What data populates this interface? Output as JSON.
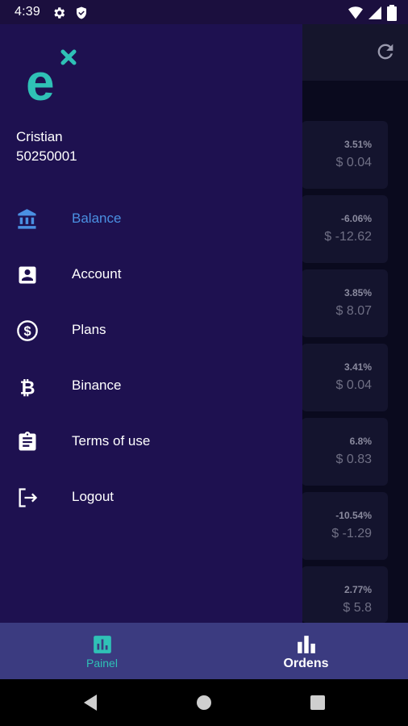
{
  "status_bar": {
    "time": "4:39",
    "left_icons": [
      "gear-icon",
      "shield-icon"
    ],
    "right_icons": [
      "wifi-icon",
      "signal-icon",
      "battery-icon"
    ]
  },
  "drawer": {
    "logo": "e",
    "user": {
      "name": "Cristian",
      "id": "50250001"
    },
    "menu": [
      {
        "label": "Balance",
        "icon": "bank-icon",
        "active": true
      },
      {
        "label": "Account",
        "icon": "account-box-icon",
        "active": false
      },
      {
        "label": "Plans",
        "icon": "dollar-circle-icon",
        "active": false
      },
      {
        "label": "Binance",
        "icon": "bitcoin-icon",
        "active": false
      },
      {
        "label": "Terms of use",
        "icon": "clipboard-icon",
        "active": false
      },
      {
        "label": "Logout",
        "icon": "logout-icon",
        "active": false
      }
    ]
  },
  "cards": [
    {
      "percent": "3.51%",
      "value": "$ 0.04"
    },
    {
      "percent": "-6.06%",
      "value": "$ -12.62"
    },
    {
      "percent": "3.85%",
      "value": "$ 8.07"
    },
    {
      "percent": "3.41%",
      "value": "$ 0.04"
    },
    {
      "percent": "6.8%",
      "value": "$ 0.83"
    },
    {
      "percent": "-10.54%",
      "value": "$ -1.29"
    },
    {
      "percent": "2.77%",
      "value": "$ 5.8"
    }
  ],
  "bottom_nav": {
    "tabs": [
      {
        "label": "Painel",
        "icon": "chart-box-icon",
        "active": true
      },
      {
        "label": "Ordens",
        "icon": "bar-chart-icon",
        "active": false
      }
    ]
  },
  "colors": {
    "drawer_bg": "#1e1150",
    "accent_active": "#4a90e2",
    "logo_teal": "#2fc1b6",
    "bottom_nav_bg": "#3b3b80"
  }
}
